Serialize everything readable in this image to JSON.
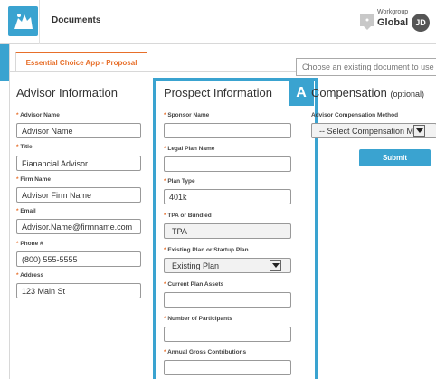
{
  "header": {
    "documents_link": "Documents",
    "workgroup_label": "Workgroup",
    "workgroup_value": "Global",
    "user_initials": "JD"
  },
  "tab": {
    "label": "Essential Choice App - Proposal"
  },
  "document_picker": {
    "placeholder": "Choose an existing document to use a..."
  },
  "advisor": {
    "title": "Advisor Information",
    "fields": [
      {
        "label": "Advisor Name",
        "value": "Advisor Name"
      },
      {
        "label": "Title",
        "value": "Fianancial Advisor"
      },
      {
        "label": "Firm Name",
        "value": "Advisor Firm Name"
      },
      {
        "label": "Email",
        "value": "Advisor.Name@firmname.com"
      },
      {
        "label": "Phone #",
        "value": "(800) 555-5555"
      },
      {
        "label": "Address",
        "value": "123 Main St"
      }
    ]
  },
  "prospect": {
    "title": "Prospect Information",
    "badge": "A",
    "fields": [
      {
        "label": "Sponsor Name",
        "value": ""
      },
      {
        "label": "Legal Plan Name",
        "value": ""
      },
      {
        "label": "Plan Type",
        "value": "401k"
      },
      {
        "label": "TPA or Bundled",
        "value": "TPA"
      },
      {
        "label": "Existing Plan or Startup Plan",
        "value": "Existing Plan"
      },
      {
        "label": "Current Plan Assets",
        "value": ""
      },
      {
        "label": "Number of Participants",
        "value": ""
      },
      {
        "label": "Annual Gross Contributions",
        "value": ""
      }
    ]
  },
  "compensation": {
    "title": "Compensation",
    "optional": "(optional)",
    "method_label": "Advisor Compensation Method",
    "method_value": "-- Select Compensation Meth",
    "submit_label": "Submit"
  },
  "colors": {
    "accent": "#3aa3d0",
    "tab_orange": "#e76f2a"
  }
}
